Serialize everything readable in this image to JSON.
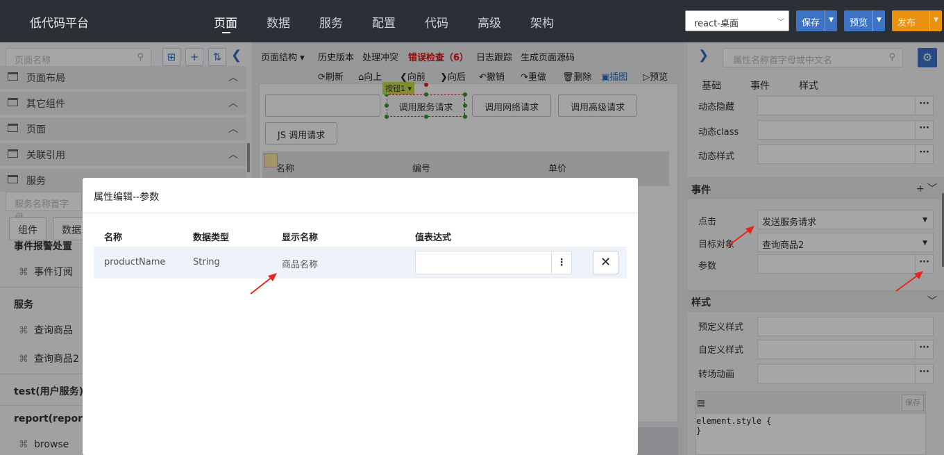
{
  "app": {
    "title": "低代码平台"
  },
  "nav": [
    "页面",
    "数据",
    "服务",
    "配置",
    "代码",
    "高级",
    "架构"
  ],
  "header": {
    "framework": "react-桌面",
    "save": "保存",
    "preview": "预览",
    "publish": "发布"
  },
  "left": {
    "search_placeholder": "页面名称",
    "tree": [
      "页面布局",
      "其它组件",
      "页面",
      "关联引用",
      "服务"
    ],
    "svc_search_placeholder": "服务名称首字母",
    "tabs": [
      "组件",
      "数据"
    ],
    "sections": [
      {
        "title": "事件报警处置",
        "items": [
          "事件订阅"
        ]
      },
      {
        "title": "服务",
        "items": [
          "查询商品",
          "查询商品2"
        ]
      },
      {
        "title": "test(用户服务)",
        "items": []
      },
      {
        "title": "report(reportu",
        "items": [
          "browse"
        ]
      }
    ]
  },
  "center": {
    "toolbar": [
      "页面结构",
      "历史版本",
      "处理冲突",
      "错误检查（6）",
      "日志跟踪",
      "生成页面源码"
    ],
    "toolbar2": [
      "刷新",
      "向上",
      "向前",
      "向后",
      "撤销",
      "重做",
      "删除",
      "插图",
      "预览"
    ],
    "tag": "按钮1",
    "buttons": [
      "调用服务请求",
      "调用网络请求",
      "调用高级请求",
      "JS 调用请求"
    ],
    "table_headers": [
      "名称",
      "编号",
      "单价"
    ]
  },
  "right": {
    "search_placeholder": "属性名称首字母或中文名",
    "tabs": [
      "基础",
      "事件",
      "样式"
    ],
    "props": {
      "dyn_hide": "动态隐藏",
      "dyn_class": "动态class",
      "dyn_style": "动态样式"
    },
    "events": {
      "header": "事件",
      "click": "点击",
      "click_value": "发送服务请求",
      "target": "目标对象",
      "target_value": "查询商品2",
      "param": "参数"
    },
    "style": {
      "header": "样式",
      "predef": "预定义样式",
      "custom": "自定义样式",
      "transition": "转场动画",
      "code_save": "保存",
      "code_line1": "element.style {",
      "code_line2": "}"
    }
  },
  "modal": {
    "title": "属性编辑--参数",
    "headers": [
      "名称",
      "数据类型",
      "显示名称",
      "值表达式"
    ],
    "row": {
      "name": "productName",
      "type": "String",
      "display": "商品名称",
      "value": ""
    }
  },
  "colors": {
    "topbar": "#2b2f36",
    "accent": "#3d72c4",
    "publish": "#e8920f",
    "error": "#dd1111",
    "arrow": "#e8251b"
  }
}
